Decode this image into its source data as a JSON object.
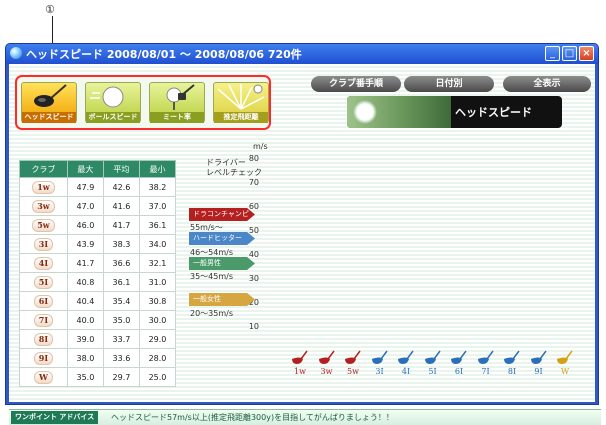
{
  "annotation": {
    "marker": "①"
  },
  "window": {
    "title": "ヘッドスピード 2008/08/01 ～ 2008/08/06 720件",
    "icon": "globe-icon",
    "buttons": [
      "minimize-icon",
      "maximize-icon",
      "close-icon"
    ],
    "accent": "#2f57c8"
  },
  "toolbar": {
    "items": [
      {
        "label": "ヘッドスピード",
        "icon": "driver-head-icon"
      },
      {
        "label": "ボールスピード",
        "icon": "ball-icon"
      },
      {
        "label": "ミート率",
        "icon": "ball-tee-icon"
      },
      {
        "label": "推定飛距離",
        "icon": "sunburst-icon"
      }
    ]
  },
  "nav": {
    "club_order": "クラブ番手順",
    "by_date": "日付別",
    "show_all": "全表示",
    "banner_title": "ヘッドスピード"
  },
  "table": {
    "headers": [
      "クラブ",
      "最大",
      "平均",
      "最小"
    ],
    "rows": [
      [
        "1w",
        "47.9",
        "42.6",
        "38.2"
      ],
      [
        "3w",
        "47.0",
        "41.6",
        "37.0"
      ],
      [
        "5w",
        "46.0",
        "41.7",
        "36.1"
      ],
      [
        "3I",
        "43.9",
        "38.3",
        "34.0"
      ],
      [
        "4I",
        "41.7",
        "36.6",
        "32.1"
      ],
      [
        "5I",
        "40.8",
        "36.1",
        "31.0"
      ],
      [
        "6I",
        "40.4",
        "35.4",
        "30.8"
      ],
      [
        "7I",
        "40.0",
        "35.0",
        "30.0"
      ],
      [
        "8I",
        "39.0",
        "33.7",
        "29.0"
      ],
      [
        "9I",
        "38.0",
        "33.6",
        "28.0"
      ],
      [
        "W",
        "35.0",
        "29.7",
        "25.0"
      ]
    ]
  },
  "scale": {
    "unit": "m/s",
    "driver_line1": "ドライバー",
    "driver_line2": "レベルチェック",
    "ticks": [
      "80",
      "70",
      "60",
      "50",
      "40",
      "30",
      "20",
      "10"
    ]
  },
  "categories": {
    "champion": {
      "label": "ドラコンチャンピオン",
      "range": "55m/s～",
      "color": "#b42020"
    },
    "hitter": {
      "label": "ハードヒッター",
      "range": "46～54m/s",
      "color": "#4a86c8"
    },
    "male": {
      "label": "一般男性",
      "range": "35～45m/s",
      "color": "#4a9a6a"
    },
    "female": {
      "label": "一般女性",
      "range": "20～35m/s",
      "color": "#d6a640"
    }
  },
  "clubs": [
    {
      "name": "1w",
      "color": "#b42020"
    },
    {
      "name": "3w",
      "color": "#b42020"
    },
    {
      "name": "5w",
      "color": "#b42020"
    },
    {
      "name": "3I",
      "color": "#2a6fb8"
    },
    {
      "name": "4I",
      "color": "#2a6fb8"
    },
    {
      "name": "5I",
      "color": "#2a6fb8"
    },
    {
      "name": "6I",
      "color": "#2a6fb8"
    },
    {
      "name": "7I",
      "color": "#2a6fb8"
    },
    {
      "name": "8I",
      "color": "#2a6fb8"
    },
    {
      "name": "9I",
      "color": "#2a6fb8"
    },
    {
      "name": "W",
      "color": "#d6a016"
    }
  ],
  "status": {
    "tip_label": "ワンポイント アドバイス",
    "tip_text": "ヘッドスピード57m/s以上(推定飛距離300y)を目指してがんばりましょう！！"
  }
}
